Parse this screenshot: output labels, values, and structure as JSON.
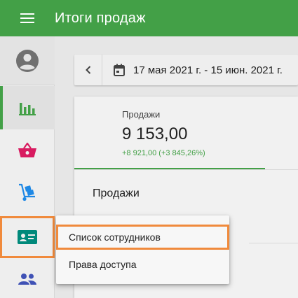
{
  "header": {
    "title": "Итоги продаж",
    "menu_icon": "hamburger-menu-icon"
  },
  "sidebar": {
    "items": [
      {
        "id": "profile",
        "icon": "account-circle-icon"
      },
      {
        "id": "analytics",
        "icon": "bar-chart-icon",
        "active": true
      },
      {
        "id": "sales",
        "icon": "basket-icon"
      },
      {
        "id": "inventory",
        "icon": "hand-truck-icon"
      },
      {
        "id": "employees",
        "icon": "badge-icon",
        "highlighted": true
      },
      {
        "id": "customers",
        "icon": "people-icon"
      }
    ]
  },
  "date_range": {
    "prev_icon": "chevron-left-icon",
    "calendar_icon": "calendar-icon",
    "text": "17 мая 2021 г. - 15 июн. 2021 г."
  },
  "metric": {
    "label": "Продажи",
    "value": "9 153,00",
    "delta": "+8 921,00 (+3 845,26%)"
  },
  "section": {
    "title": "Продажи"
  },
  "popup_menu": {
    "items": [
      {
        "label": "Список сотрудников",
        "highlighted": true
      },
      {
        "label": "Права доступа"
      }
    ]
  },
  "colors": {
    "primary": "#43a047",
    "highlight": "#f08a3c",
    "basket": "#d81b60",
    "truck": "#1e88e5",
    "employees": "#00897b",
    "people": "#3f51b5"
  }
}
